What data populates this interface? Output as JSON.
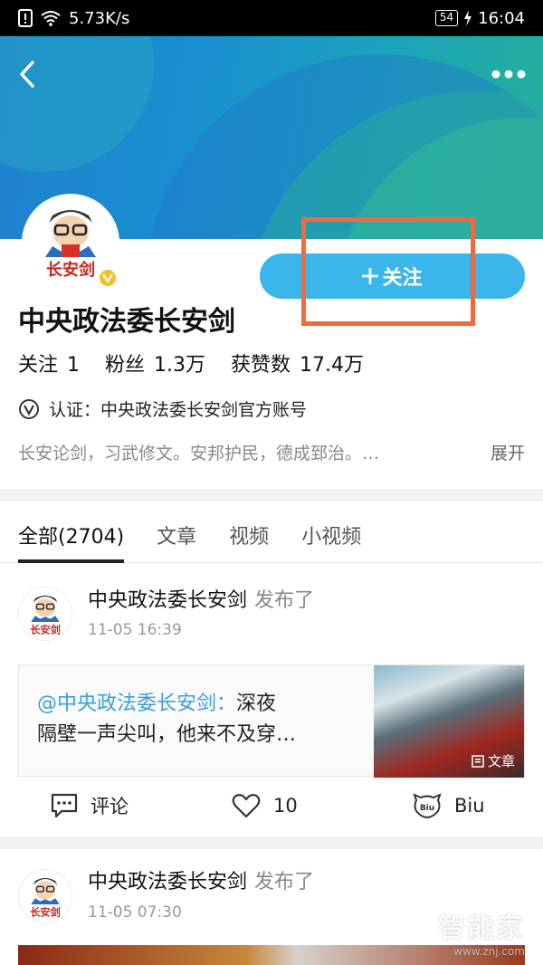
{
  "status_bar": {
    "speed": "5.73K/s",
    "battery": "54",
    "time": "16:04"
  },
  "profile": {
    "name": "中央政法委长安剑",
    "avatar_text": "长安剑",
    "follow_label": "关注",
    "stats": [
      {
        "label": "关注",
        "value": "1"
      },
      {
        "label": "粉丝",
        "value": "1.3万"
      },
      {
        "label": "获赞数",
        "value": "17.4万"
      }
    ],
    "verification": "认证：中央政法委长安剑官方账号",
    "bio": "长安论剑，习武修文。安邦护民，德成郅治。…",
    "expand_label": "展开"
  },
  "tabs": [
    "全部(2704)",
    "文章",
    "视频",
    "小视频"
  ],
  "posts": [
    {
      "author": "中央政法委长安剑",
      "action": "发布了",
      "time": "11-05 16:39",
      "card_at": "@中央政法委长安剑：",
      "card_text_1": "深夜",
      "card_text_2": "隔壁一声尖叫，他来不及穿…",
      "card_tag": "文章",
      "comment_label": "评论",
      "like_count": "10",
      "biu_label": "Biu"
    },
    {
      "author": "中央政法委长安剑",
      "action": "发布了",
      "time": "11-05 07:30"
    }
  ],
  "watermark": {
    "text": "智能家",
    "sub": "www.znj.com"
  },
  "colors": {
    "accent": "#3bb6ea",
    "highlight": "#f16a3d",
    "link": "#3aa0dd",
    "badge": "#f4c02a"
  }
}
